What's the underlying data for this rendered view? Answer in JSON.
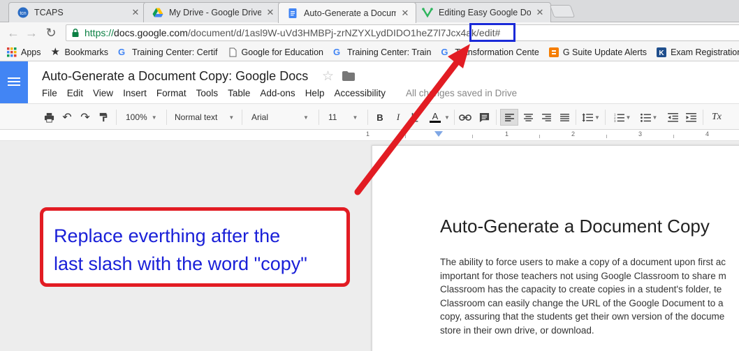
{
  "tabs": [
    {
      "label": "TCAPS",
      "active": false
    },
    {
      "label": "My Drive - Google Drive",
      "active": false
    },
    {
      "label": "Auto-Generate a Docum",
      "active": true
    },
    {
      "label": "Editing Easy Google Doc",
      "active": false
    }
  ],
  "address_bar": {
    "scheme": "https://",
    "host": "docs.google.com",
    "path": "/document/d/1asl9W-uVd3HMBPj-zrNZYXLydDIDO1heZ7l7Jcx4ak/edit#"
  },
  "bookmarks": [
    {
      "label": "Apps",
      "icon": "apps-grid-icon"
    },
    {
      "label": "Bookmarks",
      "icon": "star-icon"
    },
    {
      "label": "Training Center: Certif",
      "icon": "google-g-icon"
    },
    {
      "label": "Google for Education",
      "icon": "page-icon"
    },
    {
      "label": "Training Center: Train",
      "icon": "google-g-icon"
    },
    {
      "label": "Transformation Cente",
      "icon": "google-g-icon"
    },
    {
      "label": "G Suite Update Alerts",
      "icon": "blogger-icon"
    },
    {
      "label": "Exam Registration",
      "icon": "kryterion-icon"
    }
  ],
  "doc": {
    "title": "Auto-Generate a Document Copy: Google Docs",
    "menus": [
      "File",
      "Edit",
      "View",
      "Insert",
      "Format",
      "Tools",
      "Table",
      "Add-ons",
      "Help",
      "Accessibility"
    ],
    "save_status": "All changes saved in Drive"
  },
  "toolbar": {
    "zoom": "100%",
    "style": "Normal text",
    "font": "Arial",
    "size": "11",
    "bold": "B",
    "italic": "I",
    "text_color": "A",
    "clear_format": "Tx"
  },
  "ruler": {
    "marks": [
      "1",
      "1",
      "2",
      "3",
      "4"
    ]
  },
  "page": {
    "heading": "Auto-Generate a Document Copy",
    "body_lines": [
      "The ability to force users to make a copy of a document upon first ac",
      "important for those teachers not using Google Classroom to share m",
      "Classroom has the capacity to create copies in a student's folder, te",
      "Classroom can easily change the URL of the Google Document to a",
      "copy, assuring that the students get their own version of the docume",
      "store in their own drive, or download."
    ]
  },
  "annotation": {
    "line1": "Replace everthing after the",
    "line2": "last slash with the word \"copy\"",
    "box_color": "#e21c23",
    "text_color": "#1a20d8",
    "highlight_color": "#1a2ad8"
  },
  "colors": {
    "docs_blue": "#4285f4",
    "url_green": "#0b8043"
  }
}
